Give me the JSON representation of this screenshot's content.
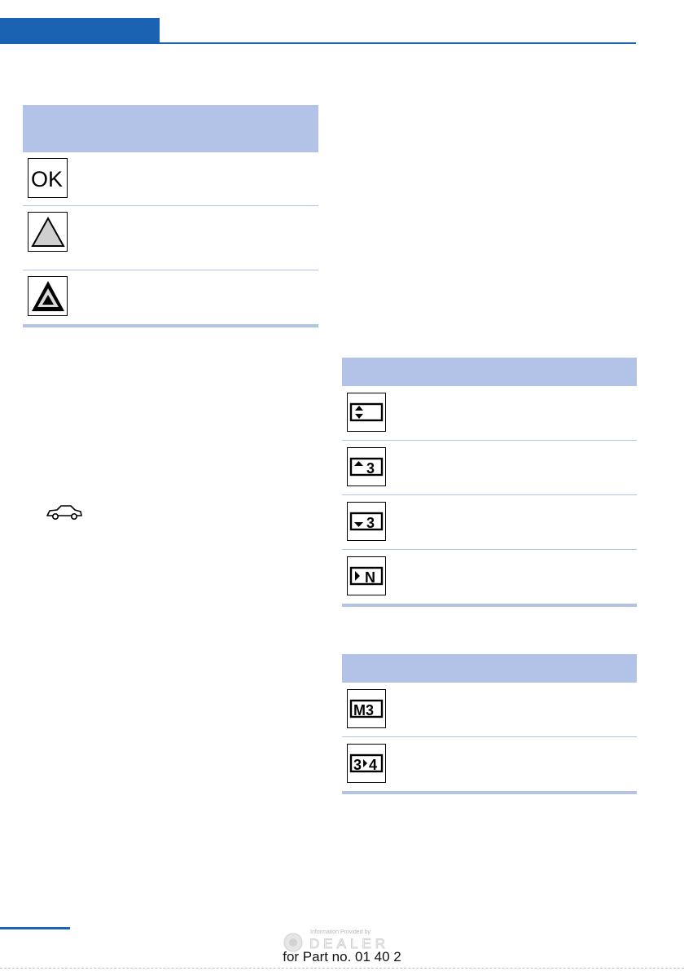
{
  "table_left": {
    "rows": [
      {
        "icon": "ok-indicator-icon"
      },
      {
        "icon": "warning-triangle-light-icon"
      },
      {
        "icon": "warning-triangle-dark-icon"
      }
    ]
  },
  "symbol_left": {
    "icon": "car-outline-icon"
  },
  "table_right_top": {
    "rows": [
      {
        "icon": "shift-up-down-icon"
      },
      {
        "icon": "upshift-gear-3-icon"
      },
      {
        "icon": "downshift-gear-3-icon"
      },
      {
        "icon": "shift-to-neutral-icon"
      }
    ]
  },
  "table_right_bottom": {
    "rows": [
      {
        "icon": "manual-gear-m3-icon"
      },
      {
        "icon": "gear-change-3-to-4-icon"
      }
    ]
  },
  "footer": {
    "watermark_line1": "Information Provided by:",
    "watermark_line2": "DEALER",
    "part_number": "for Part no. 01 40 2"
  },
  "colors": {
    "accent_blue": "#1c62b3",
    "table_header": "#b3c2e7"
  }
}
